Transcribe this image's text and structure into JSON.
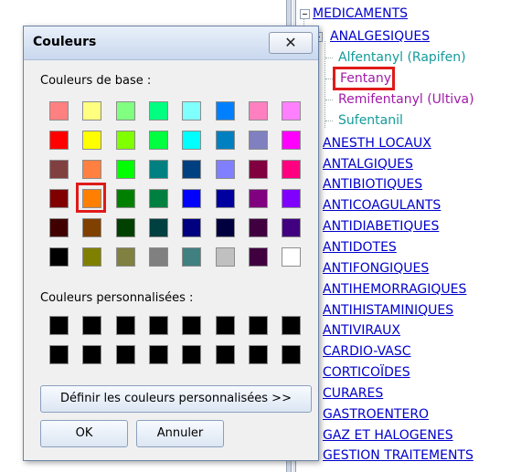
{
  "dialog": {
    "title": "Couleurs",
    "close_glyph": "✕",
    "base_colors_label": "Couleurs de base :",
    "custom_colors_label": "Couleurs personnalisées :",
    "define_custom_label": "Définir les couleurs personnalisées >>",
    "ok_label": "OK",
    "cancel_label": "Annuler",
    "selected_swatch": "row 4, column 2",
    "base_colors": [
      [
        "#FF8080",
        "#FFFF80",
        "#80FF80",
        "#00FF80",
        "#80FFFF",
        "#0080FF",
        "#FF80C0",
        "#FF80FF"
      ],
      [
        "#FF0000",
        "#FFFF00",
        "#80FF00",
        "#00FF40",
        "#00FFFF",
        "#0080C0",
        "#8080C0",
        "#FF00FF"
      ],
      [
        "#804040",
        "#FF8040",
        "#00FF00",
        "#008080",
        "#004080",
        "#8080FF",
        "#800040",
        "#FF0080"
      ],
      [
        "#800000",
        "#FF8000",
        "#008000",
        "#008040",
        "#0000FF",
        "#0000A0",
        "#800080",
        "#8000FF"
      ],
      [
        "#400000",
        "#804000",
        "#004000",
        "#004040",
        "#000080",
        "#000040",
        "#400040",
        "#400080"
      ],
      [
        "#000000",
        "#808000",
        "#808040",
        "#808080",
        "#408080",
        "#C0C0C0",
        "#400040",
        "#FFFFFF"
      ]
    ]
  },
  "tree": {
    "root_label": "MEDICAMENTS",
    "group_label": "ANALGESIQUES",
    "children": [
      {
        "label": "Alfentanyl (Rapifen)",
        "color": "#159a9a"
      },
      {
        "label": "Fentanyl",
        "color": "#a01aa8"
      },
      {
        "label": "Remifentanyl (Ultiva)",
        "color": "#a01aa8"
      },
      {
        "label": "Sufentanil",
        "color": "#159a9a"
      }
    ],
    "categories": [
      "ANESTH LOCAUX",
      "ANTALGIQUES",
      "ANTIBIOTIQUES",
      "ANTICOAGULANTS",
      "ANTIDIABETIQUES",
      "ANTIDOTES",
      "ANTIFONGIQUES",
      "ANTIHEMORRAGIQUES",
      "ANTIHISTAMINIQUES",
      "ANTIVIRAUX",
      "CARDIO-VASC",
      "CORTICOÏDES",
      "CURARES",
      "GASTROENTERO",
      "GAZ ET HALOGENES",
      "GESTION TRAITEMENTS"
    ]
  },
  "accent": "#e01a1a"
}
